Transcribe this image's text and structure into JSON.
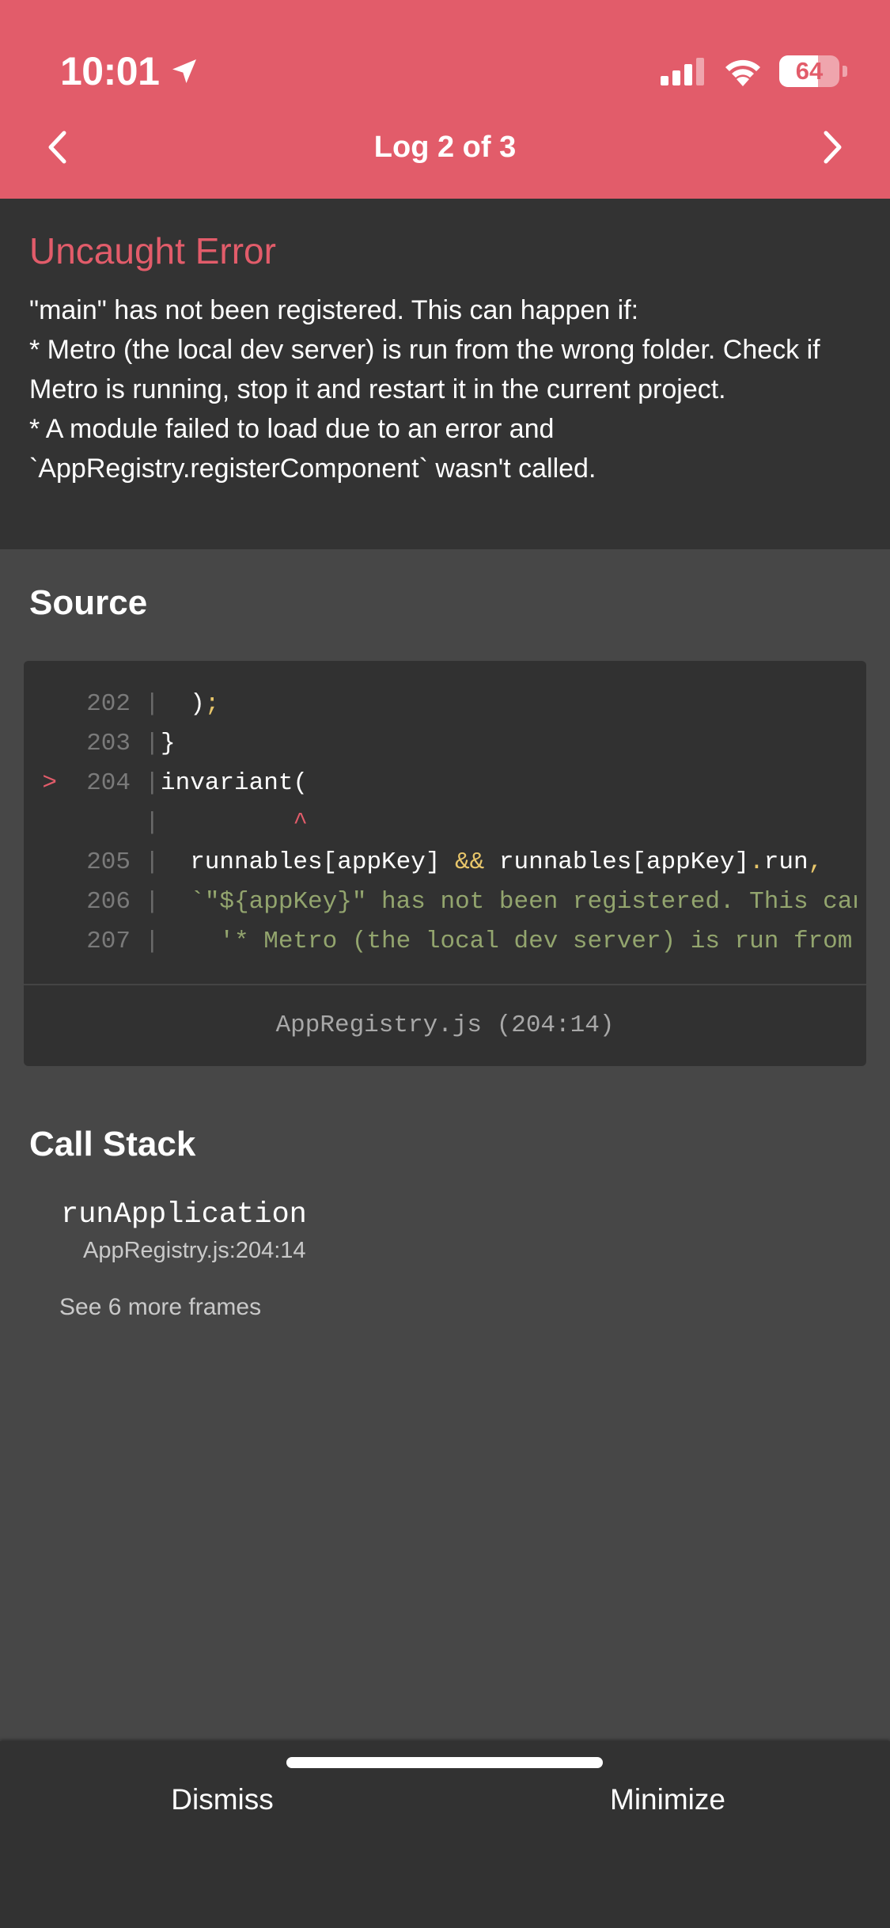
{
  "status_bar": {
    "time": "10:01",
    "battery": "64",
    "battery_level": 0.64
  },
  "header": {
    "title": "Log 2 of 3",
    "back_icon": "chevron-left-icon",
    "next_icon": "chevron-right-icon",
    "background": "#e25c6a"
  },
  "error": {
    "title": "Uncaught Error",
    "message": "\"main\" has not been registered. This can happen if:\n* Metro (the local dev server) is run from the wrong folder. Check if Metro is running, stop it and restart it in the current project.\n* A module failed to load due to an error and `AppRegistry.registerComponent` wasn't called."
  },
  "source": {
    "heading": "Source",
    "lines": [
      {
        "marker": "",
        "num": "202",
        "code": "  );"
      },
      {
        "marker": "",
        "num": "203",
        "code": "}"
      },
      {
        "marker": ">",
        "num": "204",
        "code": "invariant("
      },
      {
        "marker": "",
        "num": "",
        "code": "         ^"
      },
      {
        "marker": "",
        "num": "205",
        "code": "  runnables[appKey] && runnables[appKey].run,"
      },
      {
        "marker": "",
        "num": "206",
        "code": "  `\"${appKey}\" has not been registered. This can"
      },
      {
        "marker": "",
        "num": "207",
        "code": "    '* Metro (the local dev server) is run from t"
      }
    ],
    "file": "AppRegistry.js (204:14)"
  },
  "call_stack": {
    "heading": "Call Stack",
    "frames": [
      {
        "method": "runApplication",
        "location": "AppRegistry.js:204:14"
      }
    ],
    "see_more": "See 6 more frames"
  },
  "footer": {
    "dismiss": "Dismiss",
    "minimize": "Minimize"
  }
}
